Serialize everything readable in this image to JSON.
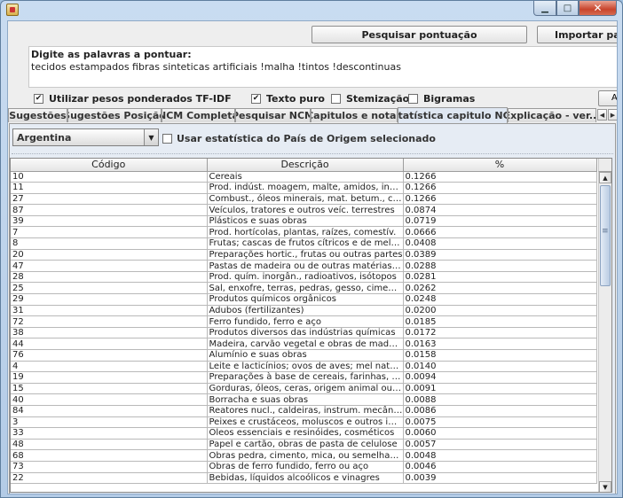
{
  "toolbar": {
    "pesquisar_label": "Pesquisar pontuação",
    "importar_label": "Importar palavras"
  },
  "query": {
    "label": "Digite as palavras a pontuar:",
    "value": "tecidos estampados fibras sinteticas artificiais !malha !tintos !descontinuas"
  },
  "options": {
    "tfidf": {
      "label": "Utilizar pesos ponderados TF-IDF",
      "checked": true
    },
    "texto_puro": {
      "label": "Texto puro",
      "checked": true
    },
    "stemizacao": {
      "label": "Stemização",
      "checked": false
    },
    "bigramas": {
      "label": "Bigramas",
      "checked": false
    }
  },
  "right_stub_label": "A",
  "tabs": [
    {
      "label": "Sugestões",
      "active": false
    },
    {
      "label": "Sugestões Posição",
      "active": false
    },
    {
      "label": "NCM Completa",
      "active": false
    },
    {
      "label": "Pesquisar NCM",
      "active": false
    },
    {
      "label": "Capitulos e notas",
      "active": false
    },
    {
      "label": "Estatística capitulo NCM",
      "active": true
    },
    {
      "label": "Explicação - ver...",
      "active": false
    }
  ],
  "panel": {
    "country": "Argentina",
    "usar_estatistica_label": "Usar estatística do País de Origem selecionado",
    "usar_estatistica_checked": false
  },
  "table": {
    "headers": [
      "Código",
      "Descrição",
      "%"
    ],
    "rows": [
      [
        "10",
        "Cereais",
        "0.1266"
      ],
      [
        "11",
        "Prod. indúst. moagem, malte, amidos, inulina",
        "0.1266"
      ],
      [
        "27",
        "Combust., óleos minerais, mat. betum., ceras",
        "0.1266"
      ],
      [
        "87",
        "Veículos, tratores e outros veíc. terrestres",
        "0.0874"
      ],
      [
        "39",
        "Plásticos e suas obras",
        "0.0719"
      ],
      [
        "7",
        "Prod. hortícolas, plantas, raízes, comestív.",
        "0.0666"
      ],
      [
        "8",
        "Frutas; cascas de frutos cítricos e de melões",
        "0.0408"
      ],
      [
        "20",
        "Preparações hortic., frutas ou outras partes",
        "0.0389"
      ],
      [
        "47",
        "Pastas de madeira ou de outras matérias fibros...",
        "0.0288"
      ],
      [
        "28",
        "Prod. quím. inorgân., radioativos, isótopos",
        "0.0281"
      ],
      [
        "25",
        "Sal, enxofre, terras, pedras, gesso, cimento",
        "0.0262"
      ],
      [
        "29",
        "Produtos químicos orgânicos",
        "0.0248"
      ],
      [
        "31",
        "Adubos (fertilizantes)",
        "0.0200"
      ],
      [
        "72",
        "Ferro fundido, ferro e aço",
        "0.0185"
      ],
      [
        "38",
        "Produtos diversos das indústrias químicas",
        "0.0172"
      ],
      [
        "44",
        "Madeira, carvão vegetal e obras de madeira",
        "0.0163"
      ],
      [
        "76",
        "Alumínio e suas obras",
        "0.0158"
      ],
      [
        "4",
        "Leite e lacticínios; ovos de aves; mel natural; pr...",
        "0.0140"
      ],
      [
        "19",
        "Preparações à base de cereais, farinhas, amid...",
        "0.0094"
      ],
      [
        "15",
        "Gorduras, óleos, ceras, origem animal ou veg.",
        "0.0091"
      ],
      [
        "40",
        "Borracha e suas obras",
        "0.0088"
      ],
      [
        "84",
        "Reatores nucl., caldeiras, instrum. mecânicos",
        "0.0086"
      ],
      [
        "3",
        "Peixes e crustáceos, moluscos e outros inverte...",
        "0.0075"
      ],
      [
        "33",
        "Óleos essenciais e resinóides, cosméticos",
        "0.0060"
      ],
      [
        "48",
        "Papel e cartão, obras de pasta de celulose",
        "0.0057"
      ],
      [
        "68",
        "Obras pedra, cimento, mica, ou semelhantes",
        "0.0048"
      ],
      [
        "73",
        "Obras de ferro fundido, ferro ou aço",
        "0.0046"
      ],
      [
        "22",
        "Bebidas, líquidos alcoólicos e vinagres",
        "0.0039"
      ]
    ]
  }
}
